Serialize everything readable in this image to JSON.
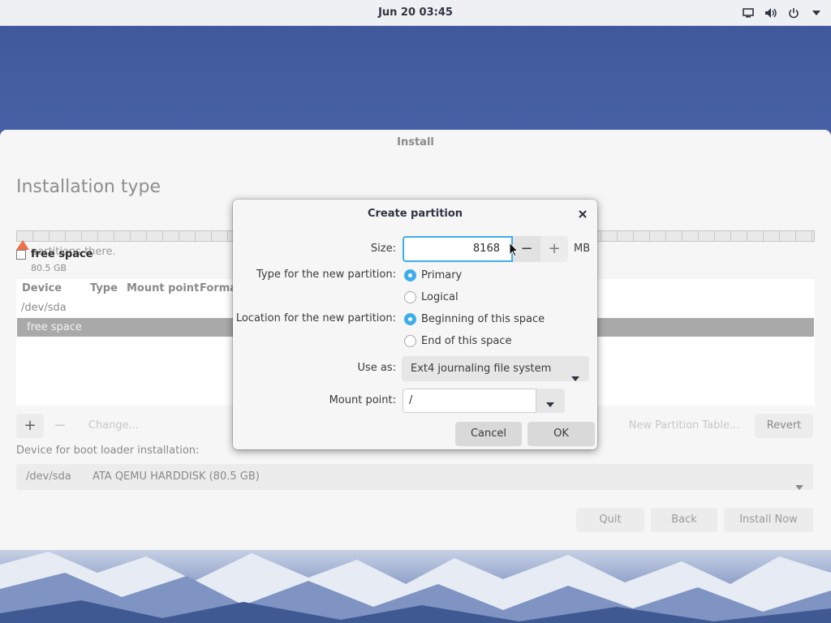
{
  "topbar": {
    "clock": "Jun 20  03:45",
    "icons": [
      "screen-icon",
      "volume-icon",
      "power-icon",
      "chevron-down-icon"
    ]
  },
  "window": {
    "title": "Install",
    "page_title": "Installation type",
    "warning_text": "partitions there.",
    "legend": {
      "name": "free space",
      "size": "80.5 GB"
    },
    "table": {
      "columns": [
        "Device",
        "Type",
        "Mount point",
        "Forma"
      ],
      "rows": [
        {
          "device": "/dev/sda"
        },
        {
          "device": "free space",
          "selected": true
        }
      ]
    },
    "toolbar": {
      "add": "+",
      "remove": "−",
      "change": "Change...",
      "new_partition_table": "New Partition Table...",
      "revert": "Revert"
    },
    "bootloader": {
      "label": "Device for boot loader installation:",
      "device": "/dev/sda",
      "description": "ATA QEMU HARDDISK (80.5 GB)"
    },
    "nav": {
      "quit": "Quit",
      "back": "Back",
      "install_now": "Install Now"
    }
  },
  "dialog": {
    "title": "Create partition",
    "size_label": "Size:",
    "size_value": "8168",
    "size_unit": "MB",
    "minus": "−",
    "plus": "+",
    "type_label": "Type for the new partition:",
    "type_options": [
      {
        "label": "Primary",
        "selected": true
      },
      {
        "label": "Logical",
        "selected": false
      }
    ],
    "location_label": "Location for the new partition:",
    "location_options": [
      {
        "label": "Beginning of this space",
        "selected": true
      },
      {
        "label": "End of this space",
        "selected": false
      }
    ],
    "use_as_label": "Use as:",
    "use_as_value": "Ext4 journaling file system",
    "mount_label": "Mount point:",
    "mount_value": "/",
    "cancel": "Cancel",
    "ok": "OK"
  },
  "colors": {
    "accent": "#3daee9",
    "selection": "#a9a9a9",
    "warning": "#e8734a"
  }
}
